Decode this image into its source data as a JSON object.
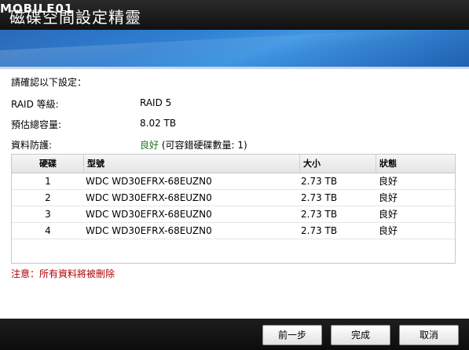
{
  "window": {
    "title": "磁碟空間設定精靈",
    "watermark": "MOBILE01"
  },
  "confirm_heading": "請確認以下設定：",
  "summary": {
    "raid_label": "RAID 等級:",
    "raid_value": "RAID 5",
    "capacity_label": "預估總容量:",
    "capacity_value": "8.02 TB",
    "protection_label": "資料防護:",
    "protection_status": "良好",
    "protection_note": "(可容錯硬碟數量: 1)"
  },
  "table": {
    "headers": [
      "硬碟",
      "型號",
      "大小",
      "狀態"
    ],
    "rows": [
      {
        "disk": "1",
        "model": "WDC WD30EFRX-68EUZN0",
        "size": "2.73 TB",
        "status": "良好"
      },
      {
        "disk": "2",
        "model": "WDC WD30EFRX-68EUZN0",
        "size": "2.73 TB",
        "status": "良好"
      },
      {
        "disk": "3",
        "model": "WDC WD30EFRX-68EUZN0",
        "size": "2.73 TB",
        "status": "良好"
      },
      {
        "disk": "4",
        "model": "WDC WD30EFRX-68EUZN0",
        "size": "2.73 TB",
        "status": "良好"
      }
    ]
  },
  "warning": "注意：所有資料將被刪除",
  "buttons": {
    "back": "前一步",
    "finish": "完成",
    "cancel": "取消"
  },
  "colors": {
    "good": "#1e7a1e",
    "warning": "#b00000",
    "banner": "#2f7fd2"
  }
}
